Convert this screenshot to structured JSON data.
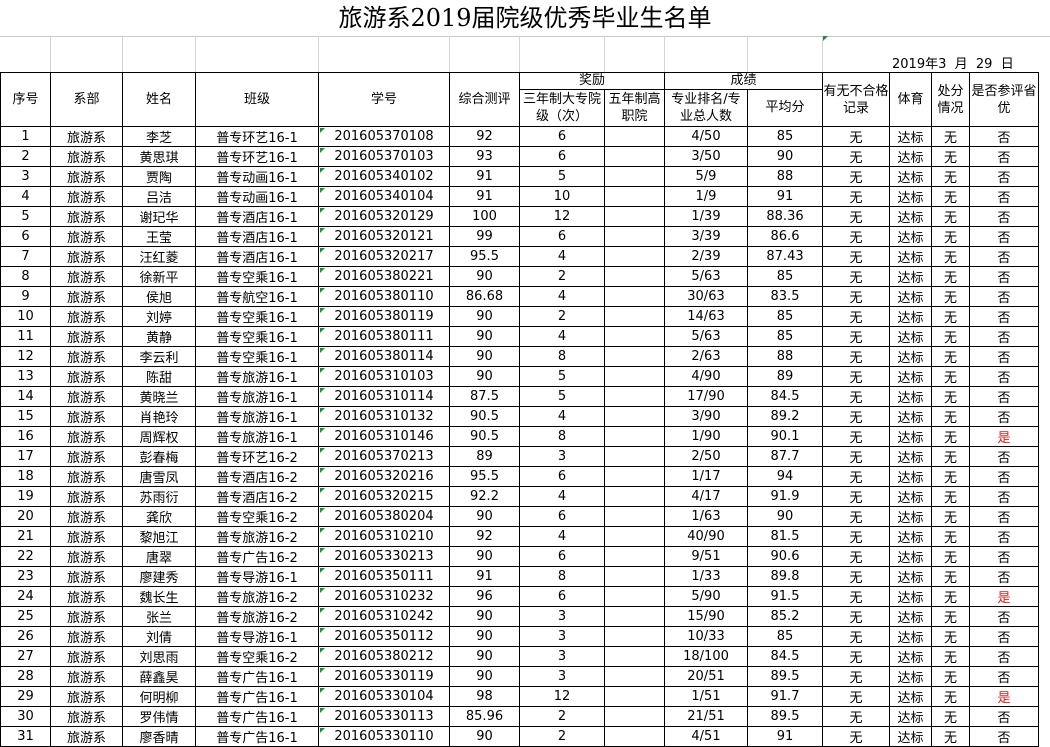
{
  "title": "旅游系2019届院级优秀毕业生名单",
  "date": "2019年3  月  29  日",
  "headers": {
    "seq": "序号",
    "dept": "系部",
    "name": "姓名",
    "class": "班级",
    "sid": "学号",
    "score": "综合测评",
    "award": "奖励",
    "award3": "三年制大专院级（次）",
    "award5": "五年制高职院",
    "grades": "成绩",
    "rank": "专业排名/专业总人数",
    "avg": "平均分",
    "fail": "有无不合格记录",
    "pe": "体育",
    "punish": "处分情况",
    "prov": "是否参评省优"
  },
  "red_color": "#e02020",
  "rows": [
    {
      "seq": "1",
      "dept": "旅游系",
      "name": "李芝",
      "class": "普专环艺16-1",
      "sid": "201605370108",
      "score": "92",
      "award3": "6",
      "award5": "",
      "rank": "4/50",
      "avg": "85",
      "fail": "无",
      "pe": "达标",
      "punish": "无",
      "prov": "否",
      "provRed": false
    },
    {
      "seq": "2",
      "dept": "旅游系",
      "name": "黄思琪",
      "class": "普专环艺16-1",
      "sid": "201605370103",
      "score": "93",
      "award3": "6",
      "award5": "",
      "rank": "3/50",
      "avg": "90",
      "fail": "无",
      "pe": "达标",
      "punish": "无",
      "prov": "否",
      "provRed": false
    },
    {
      "seq": "3",
      "dept": "旅游系",
      "name": "贾陶",
      "class": "普专动画16-1",
      "sid": "201605340102",
      "score": "91",
      "award3": "5",
      "award5": "",
      "rank": "5/9",
      "avg": "88",
      "fail": "无",
      "pe": "达标",
      "punish": "无",
      "prov": "否",
      "provRed": false
    },
    {
      "seq": "4",
      "dept": "旅游系",
      "name": "吕洁",
      "class": "普专动画16-1",
      "sid": "201605340104",
      "score": "91",
      "award3": "10",
      "award5": "",
      "rank": "1/9",
      "avg": "91",
      "fail": "无",
      "pe": "达标",
      "punish": "无",
      "prov": "否",
      "provRed": false
    },
    {
      "seq": "5",
      "dept": "旅游系",
      "name": "谢玘华",
      "class": "普专酒店16-1",
      "sid": "201605320129",
      "score": "100",
      "award3": "12",
      "award5": "",
      "rank": "1/39",
      "avg": "88.36",
      "fail": "无",
      "pe": "达标",
      "punish": "无",
      "prov": "否",
      "provRed": false
    },
    {
      "seq": "6",
      "dept": "旅游系",
      "name": "王莹",
      "class": "普专酒店16-1",
      "sid": "201605320121",
      "score": "99",
      "award3": "6",
      "award5": "",
      "rank": "3/39",
      "avg": "86.6",
      "fail": "无",
      "pe": "达标",
      "punish": "无",
      "prov": "否",
      "provRed": false
    },
    {
      "seq": "7",
      "dept": "旅游系",
      "name": "汪红菱",
      "class": "普专酒店16-1",
      "sid": "201605320217",
      "score": "95.5",
      "award3": "4",
      "award5": "",
      "rank": "2/39",
      "avg": "87.43",
      "fail": "无",
      "pe": "达标",
      "punish": "无",
      "prov": "否",
      "provRed": false
    },
    {
      "seq": "8",
      "dept": "旅游系",
      "name": "徐新平",
      "class": "普专空乘16-1",
      "sid": "201605380221",
      "score": "90",
      "award3": "2",
      "award5": "",
      "rank": "5/63",
      "avg": "85",
      "fail": "无",
      "pe": "达标",
      "punish": "无",
      "prov": "否",
      "provRed": false
    },
    {
      "seq": "9",
      "dept": "旅游系",
      "name": "侯旭",
      "class": "普专航空16-1",
      "sid": "201605380110",
      "score": "86.68",
      "award3": "4",
      "award5": "",
      "rank": "30/63",
      "avg": "83.5",
      "fail": "无",
      "pe": "达标",
      "punish": "无",
      "prov": "否",
      "provRed": false
    },
    {
      "seq": "10",
      "dept": "旅游系",
      "name": "刘婷",
      "class": "普专空乘16-1",
      "sid": "201605380119",
      "score": "90",
      "award3": "2",
      "award5": "",
      "rank": "14/63",
      "avg": "85",
      "fail": "无",
      "pe": "达标",
      "punish": "无",
      "prov": "否",
      "provRed": false
    },
    {
      "seq": "11",
      "dept": "旅游系",
      "name": "黄静",
      "class": "普专空乘16-1",
      "sid": "201605380111",
      "score": "90",
      "award3": "4",
      "award5": "",
      "rank": "5/63",
      "avg": "85",
      "fail": "无",
      "pe": "达标",
      "punish": "无",
      "prov": "否",
      "provRed": false
    },
    {
      "seq": "12",
      "dept": "旅游系",
      "name": "李云利",
      "class": "普专空乘16-1",
      "sid": "201605380114",
      "score": "90",
      "award3": "8",
      "award5": "",
      "rank": "2/63",
      "avg": "88",
      "fail": "无",
      "pe": "达标",
      "punish": "无",
      "prov": "否",
      "provRed": false
    },
    {
      "seq": "13",
      "dept": "旅游系",
      "name": "陈甜",
      "class": "普专旅游16-1",
      "sid": "201605310103",
      "score": "90",
      "award3": "5",
      "award5": "",
      "rank": "4/90",
      "avg": "89",
      "fail": "无",
      "pe": "达标",
      "punish": "无",
      "prov": "否",
      "provRed": false
    },
    {
      "seq": "14",
      "dept": "旅游系",
      "name": "黄晓兰",
      "class": "普专旅游16-1",
      "sid": "201605310114",
      "score": "87.5",
      "award3": "5",
      "award5": "",
      "rank": "17/90",
      "avg": "84.5",
      "fail": "无",
      "pe": "达标",
      "punish": "无",
      "prov": "否",
      "provRed": false
    },
    {
      "seq": "15",
      "dept": "旅游系",
      "name": "肖艳玲",
      "class": "普专旅游16-1",
      "sid": "201605310132",
      "score": "90.5",
      "award3": "4",
      "award5": "",
      "rank": "3/90",
      "avg": "89.2",
      "fail": "无",
      "pe": "达标",
      "punish": "无",
      "prov": "否",
      "provRed": false
    },
    {
      "seq": "16",
      "dept": "旅游系",
      "name": "周辉权",
      "class": "普专旅游16-1",
      "sid": "201605310146",
      "score": "90.5",
      "award3": "8",
      "award5": "",
      "rank": "1/90",
      "avg": "90.1",
      "fail": "无",
      "pe": "达标",
      "punish": "无",
      "prov": "是",
      "provRed": true
    },
    {
      "seq": "17",
      "dept": "旅游系",
      "name": "彭春梅",
      "class": "普专环艺16-2",
      "sid": "201605370213",
      "score": "89",
      "award3": "3",
      "award5": "",
      "rank": "2/50",
      "avg": "87.7",
      "fail": "无",
      "pe": "达标",
      "punish": "无",
      "prov": "否",
      "provRed": false
    },
    {
      "seq": "18",
      "dept": "旅游系",
      "name": "唐雪凤",
      "class": "普专酒店16-2",
      "sid": "201605320216",
      "score": "95.5",
      "award3": "6",
      "award5": "",
      "rank": "1/17",
      "avg": "94",
      "fail": "无",
      "pe": "达标",
      "punish": "无",
      "prov": "否",
      "provRed": false
    },
    {
      "seq": "19",
      "dept": "旅游系",
      "name": "苏雨衍",
      "class": "普专酒店16-2",
      "sid": "201605320215",
      "score": "92.2",
      "award3": "4",
      "award5": "",
      "rank": "4/17",
      "avg": "91.9",
      "fail": "无",
      "pe": "达标",
      "punish": "无",
      "prov": "否",
      "provRed": false
    },
    {
      "seq": "20",
      "dept": "旅游系",
      "name": "龚欣",
      "class": "普专空乘16-2",
      "sid": "201605380204",
      "score": "90",
      "award3": "6",
      "award5": "",
      "rank": "1/63",
      "avg": "90",
      "fail": "无",
      "pe": "达标",
      "punish": "无",
      "prov": "否",
      "provRed": false
    },
    {
      "seq": "21",
      "dept": "旅游系",
      "name": "黎旭江",
      "class": "普专旅游16-2",
      "sid": "201605310210",
      "score": "92",
      "award3": "4",
      "award5": "",
      "rank": "40/90",
      "avg": "81.5",
      "fail": "无",
      "pe": "达标",
      "punish": "无",
      "prov": "否",
      "provRed": false
    },
    {
      "seq": "22",
      "dept": "旅游系",
      "name": "唐翠",
      "class": "普专广告16-2",
      "sid": "201605330213",
      "score": "90",
      "award3": "6",
      "award5": "",
      "rank": "9/51",
      "avg": "90.6",
      "fail": "无",
      "pe": "达标",
      "punish": "无",
      "prov": "否",
      "provRed": false
    },
    {
      "seq": "23",
      "dept": "旅游系",
      "name": "廖建秀",
      "class": "普专导游16-1",
      "sid": "201605350111",
      "score": "91",
      "award3": "8",
      "award5": "",
      "rank": "1/33",
      "avg": "89.8",
      "fail": "无",
      "pe": "达标",
      "punish": "无",
      "prov": "否",
      "provRed": false
    },
    {
      "seq": "24",
      "dept": "旅游系",
      "name": "魏长生",
      "class": "普专旅游16-2",
      "sid": "201605310232",
      "score": "96",
      "award3": "6",
      "award5": "",
      "rank": "5/90",
      "avg": "91.5",
      "fail": "无",
      "pe": "达标",
      "punish": "无",
      "prov": "是",
      "provRed": true
    },
    {
      "seq": "25",
      "dept": "旅游系",
      "name": "张兰",
      "class": "普专旅游16-2",
      "sid": "201605310242",
      "score": "90",
      "award3": "3",
      "award5": "",
      "rank": "15/90",
      "avg": "85.2",
      "fail": "无",
      "pe": "达标",
      "punish": "无",
      "prov": "否",
      "provRed": false
    },
    {
      "seq": "26",
      "dept": "旅游系",
      "name": "刘倩",
      "class": "普专导游16-1",
      "sid": "201605350112",
      "score": "90",
      "award3": "3",
      "award5": "",
      "rank": "10/33",
      "avg": "85",
      "fail": "无",
      "pe": "达标",
      "punish": "无",
      "prov": "否",
      "provRed": false
    },
    {
      "seq": "27",
      "dept": "旅游系",
      "name": "刘思雨",
      "class": "普专空乘16-2",
      "sid": "201605380212",
      "score": "90",
      "award3": "3",
      "award5": "",
      "rank": "18/100",
      "avg": "84.5",
      "fail": "无",
      "pe": "达标",
      "punish": "无",
      "prov": "否",
      "provRed": false
    },
    {
      "seq": "28",
      "dept": "旅游系",
      "name": "薛鑫昊",
      "class": "普专广告16-1",
      "sid": "201605330119",
      "score": "90",
      "award3": "3",
      "award5": "",
      "rank": "20/51",
      "avg": "89.5",
      "fail": "无",
      "pe": "达标",
      "punish": "无",
      "prov": "否",
      "provRed": false
    },
    {
      "seq": "29",
      "dept": "旅游系",
      "name": "何明柳",
      "class": "普专广告16-1",
      "sid": "201605330104",
      "score": "98",
      "award3": "12",
      "award5": "",
      "rank": "1/51",
      "avg": "91.7",
      "fail": "无",
      "pe": "达标",
      "punish": "无",
      "prov": "是",
      "provRed": true
    },
    {
      "seq": "30",
      "dept": "旅游系",
      "name": "罗伟情",
      "class": "普专广告16-1",
      "sid": "201605330113",
      "score": "85.96",
      "award3": "2",
      "award5": "",
      "rank": "21/51",
      "avg": "89.5",
      "fail": "无",
      "pe": "达标",
      "punish": "无",
      "prov": "否",
      "provRed": false
    },
    {
      "seq": "31",
      "dept": "旅游系",
      "name": "廖香晴",
      "class": "普专广告16-1",
      "sid": "201605330110",
      "score": "90",
      "award3": "2",
      "award5": "",
      "rank": "4/51",
      "avg": "91",
      "fail": "无",
      "pe": "达标",
      "punish": "无",
      "prov": "否",
      "provRed": false
    }
  ]
}
